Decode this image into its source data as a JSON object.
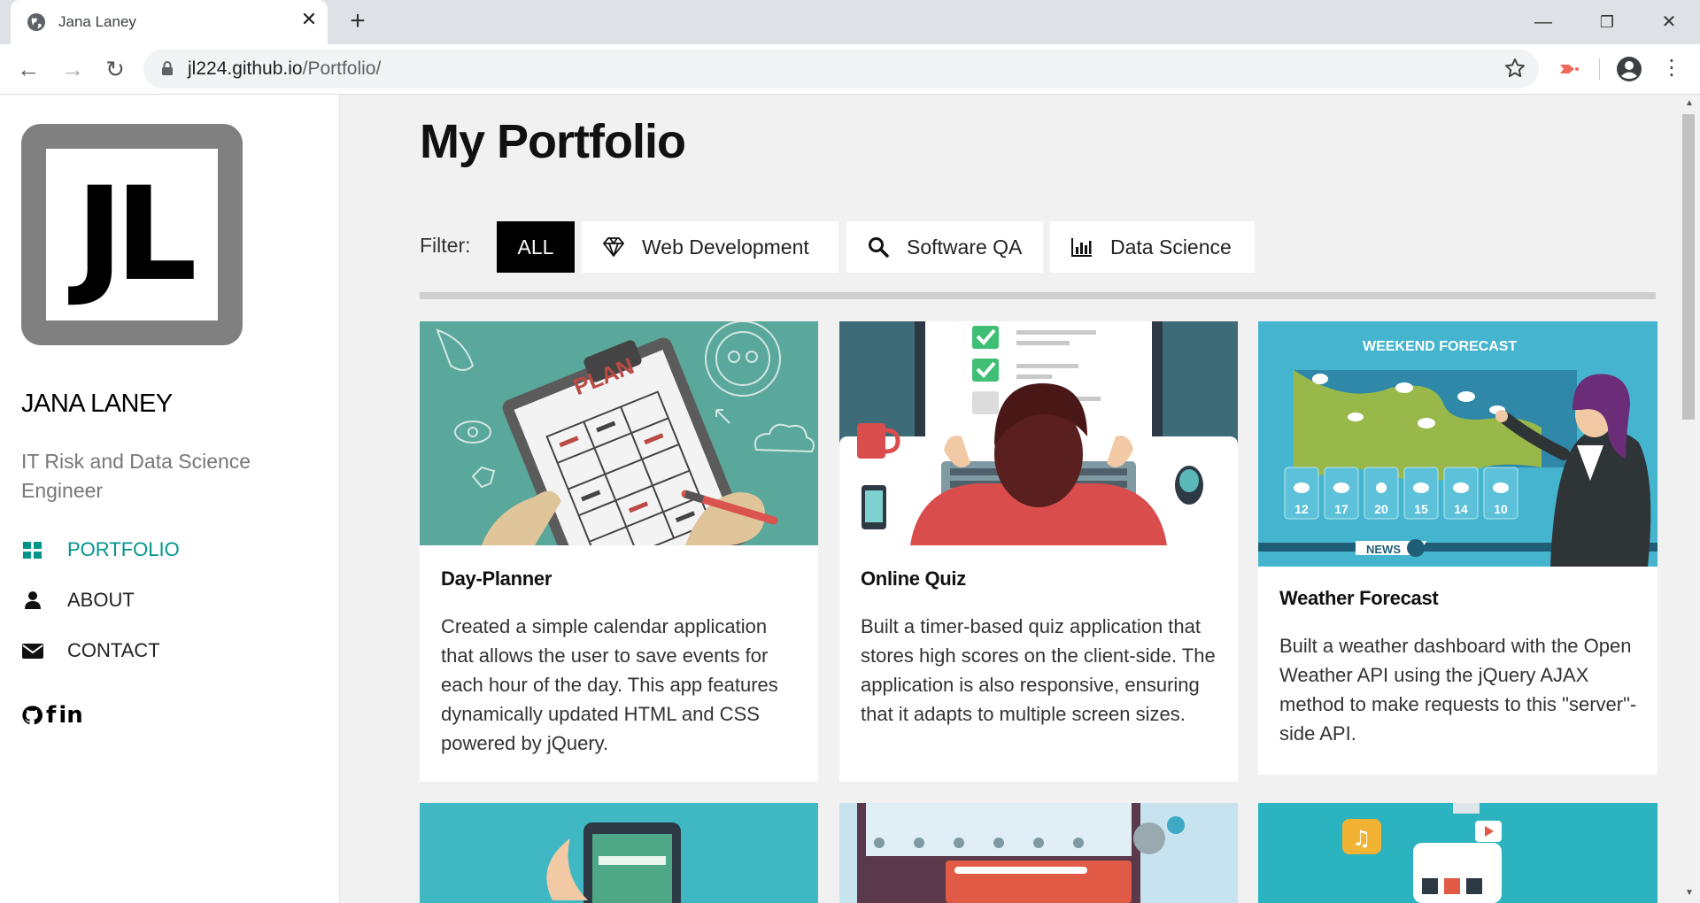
{
  "browser": {
    "tab_title": "Jana Laney",
    "url_host": "jl224.github.io",
    "url_path": "/Portfolio/"
  },
  "sidebar": {
    "logo_text": "JL",
    "name": "JANA LANEY",
    "role": "IT Risk and Data Science Engineer",
    "nav": [
      {
        "label": "PORTFOLIO",
        "icon": "grid-icon",
        "active": true
      },
      {
        "label": "ABOUT",
        "icon": "user-icon",
        "active": false
      },
      {
        "label": "CONTACT",
        "icon": "envelope-icon",
        "active": false
      }
    ],
    "social": [
      {
        "label": "github",
        "icon": "github-icon"
      },
      {
        "label": "facebook",
        "icon": "facebook-icon"
      },
      {
        "label": "linkedin",
        "icon": "linkedin-icon"
      }
    ]
  },
  "main": {
    "title": "My Portfolio",
    "filter_label": "Filter:",
    "filters": [
      {
        "label": "ALL",
        "active": true
      },
      {
        "label": "Web Development",
        "icon": "diamond-icon"
      },
      {
        "label": "Software QA",
        "icon": "search-icon"
      },
      {
        "label": "Data Science",
        "icon": "bar-chart-icon"
      }
    ],
    "cards": [
      {
        "title": "Day-Planner",
        "description": "Created a simple calendar application that allows the user to save events for each hour of the day. This app features dynamically updated HTML and CSS powered by jQuery.",
        "image_text": "PLAN"
      },
      {
        "title": "Online Quiz",
        "description": "Built a timer-based quiz application that stores high scores on the client-side. The application is also responsive, ensuring that it adapts to multiple screen sizes."
      },
      {
        "title": "Weather Forecast",
        "description": "Built a weather dashboard with the Open Weather API using the jQuery AJAX method to make requests to this \"server\"-side API.",
        "image_text": "WEEKEND FORECAST",
        "image_news": "NEWS",
        "image_temps": [
          "12",
          "17",
          "20",
          "15",
          "14",
          "10"
        ]
      }
    ]
  },
  "colors": {
    "accent": "#00958a",
    "sidebar_bg": "#ffffff",
    "content_bg": "#f1f1f1"
  }
}
